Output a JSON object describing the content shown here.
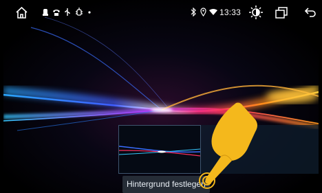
{
  "status_bar": {
    "time": "13:33",
    "left_icons": [
      "home-icon",
      "car-icon",
      "phone-icon",
      "usb-icon",
      "android-debug-icon",
      "dot-icon"
    ],
    "right_icons": [
      "bluetooth-icon",
      "location-icon",
      "wifi-icon",
      "brightness-icon",
      "recent-apps-icon",
      "back-icon"
    ]
  },
  "wallpaper": {
    "colors": [
      "#1e6cff",
      "#b13cff",
      "#ff2d6a",
      "#ff8a1a",
      "#ffd23a",
      "#35c8ff"
    ]
  },
  "preview": {
    "border_color": "#78a0c8"
  },
  "actions": {
    "set_wallpaper_label": "Hintergrund festlegen"
  },
  "overlay": {
    "hand_color": "#f4b81c"
  }
}
